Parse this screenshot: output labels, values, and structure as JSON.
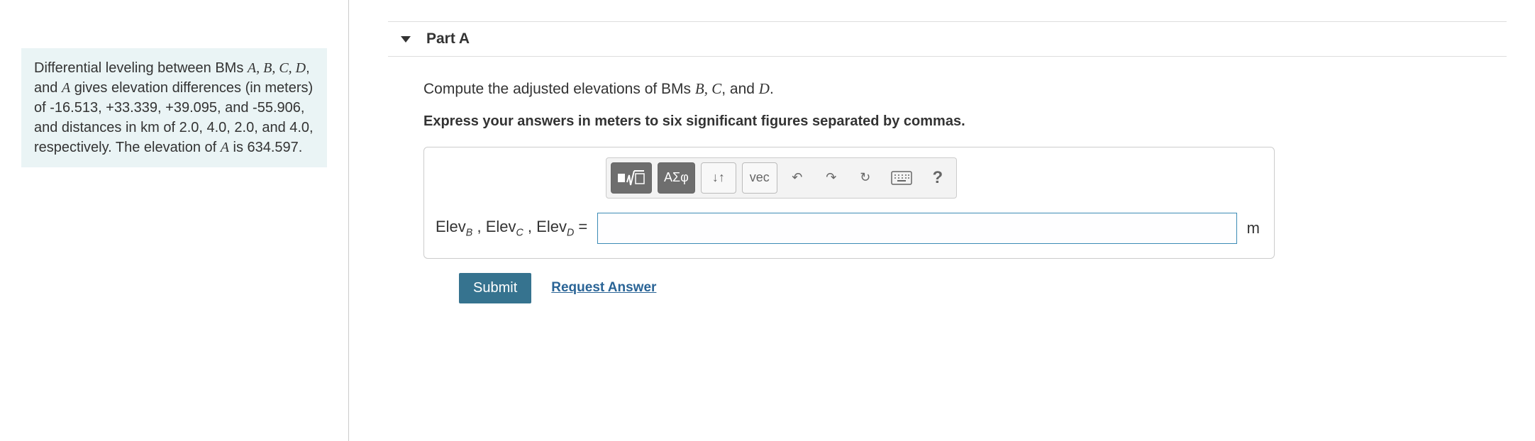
{
  "problem": {
    "text_pre": "Differential leveling between BMs ",
    "letters": "A, B, C, D",
    "text_mid1": ", and ",
    "letter_a": "A",
    "text_mid2": " gives elevation differences (in meters) of -16.513, +33.339, +39.095, and -55.906, and distances in ",
    "km": "km",
    "text_mid3": " of 2.0, 4.0, 2.0, and 4.0, respectively. The elevation of ",
    "letter_a2": "A",
    "text_end": " is 634.597."
  },
  "part": {
    "label": "Part A",
    "question_pre": "Compute the adjusted elevations of BMs ",
    "question_letters": "B, C",
    "question_mid": ", and ",
    "question_d": "D",
    "question_end": ".",
    "instruction": "Express your answers in meters to six significant figures separated by commas.",
    "vars": {
      "b": "Elev",
      "b_sub": "B",
      "c": "Elev",
      "c_sub": "C",
      "d": "Elev",
      "d_sub": "D",
      "eq": " = "
    },
    "unit": "m"
  },
  "toolbar": {
    "template": "x√□",
    "greek": "ΑΣφ",
    "subscript": "↓↑",
    "vec": "vec",
    "undo": "↶",
    "redo": "↷",
    "reset": "↻",
    "keyboard": "⌨",
    "help": "?"
  },
  "buttons": {
    "submit": "Submit",
    "request": "Request Answer"
  },
  "input": {
    "value": ""
  }
}
